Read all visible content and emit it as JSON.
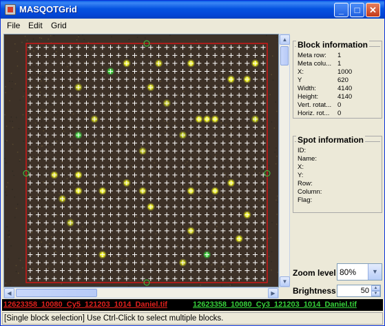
{
  "window": {
    "title": "MASQOTGrid",
    "buttons": [
      "minimize",
      "maximize",
      "close"
    ]
  },
  "menu": {
    "items": [
      "File",
      "Edit",
      "Grid"
    ]
  },
  "block_info": {
    "title": "Block information",
    "rows": [
      {
        "k": "Meta row:",
        "v": "1"
      },
      {
        "k": "Meta colu...",
        "v": "1"
      },
      {
        "k": "X:",
        "v": "1000"
      },
      {
        "k": "Y",
        "v": "620"
      },
      {
        "k": "Width:",
        "v": "4140"
      },
      {
        "k": "Height:",
        "v": "4140"
      },
      {
        "k": "Vert. rotat...",
        "v": "0"
      },
      {
        "k": "Horiz. rot...",
        "v": "0"
      }
    ]
  },
  "spot_info": {
    "title": "Spot information",
    "rows": [
      {
        "k": "ID:",
        "v": ""
      },
      {
        "k": "Name:",
        "v": ""
      },
      {
        "k": "X:",
        "v": ""
      },
      {
        "k": "Y:",
        "v": ""
      },
      {
        "k": "Row:",
        "v": ""
      },
      {
        "k": "Column:",
        "v": ""
      },
      {
        "k": "Flag:",
        "v": ""
      }
    ]
  },
  "zoom": {
    "label": "Zoom level",
    "value": "80%"
  },
  "brightness": {
    "label": "Brightness",
    "value": "50"
  },
  "files": {
    "cy5": "12623358_10080_Cy5_121203_1014_Daniel.tif",
    "cy3": "12623358_10080_Cy3_121203_1014_Daniel.tif",
    "cy5_color": "#e0201c",
    "cy3_color": "#36d23a"
  },
  "status": "[Single block selection] Use Ctrl-Click to select multiple blocks.",
  "grid": {
    "rows": 30,
    "cols": 30,
    "border_color": "#d01818",
    "marker_color": "#ffffff"
  },
  "spots": [
    {
      "r": 2,
      "c": 12,
      "color": "#e6e81a"
    },
    {
      "r": 2,
      "c": 16,
      "color": "#d4d41a"
    },
    {
      "r": 2,
      "c": 20,
      "color": "#e6e81a"
    },
    {
      "r": 2,
      "c": 28,
      "color": "#e6e81a"
    },
    {
      "r": 3,
      "c": 10,
      "color": "#3fd23f"
    },
    {
      "r": 4,
      "c": 25,
      "color": "#e6e81a"
    },
    {
      "r": 4,
      "c": 27,
      "color": "#e6e81a"
    },
    {
      "r": 5,
      "c": 6,
      "color": "#c7cb1a"
    },
    {
      "r": 5,
      "c": 15,
      "color": "#d6da1c"
    },
    {
      "r": 9,
      "c": 21,
      "color": "#e6e81a"
    },
    {
      "r": 9,
      "c": 22,
      "color": "#e6e81a"
    },
    {
      "r": 9,
      "c": 23,
      "color": "#e6e81a"
    },
    {
      "r": 9,
      "c": 28,
      "color": "#c6d01a"
    },
    {
      "r": 9,
      "c": 8,
      "color": "#c6c81a"
    },
    {
      "r": 11,
      "c": 6,
      "color": "#3fd23f"
    },
    {
      "r": 11,
      "c": 19,
      "color": "#b6c21a"
    },
    {
      "r": 16,
      "c": 3,
      "color": "#d6d81a"
    },
    {
      "r": 16,
      "c": 6,
      "color": "#e6e81a"
    },
    {
      "r": 17,
      "c": 12,
      "color": "#d6d81a"
    },
    {
      "r": 17,
      "c": 25,
      "color": "#e6e81a"
    },
    {
      "r": 18,
      "c": 6,
      "color": "#e6e81a"
    },
    {
      "r": 18,
      "c": 9,
      "color": "#e6e81a"
    },
    {
      "r": 18,
      "c": 14,
      "color": "#d6d81a"
    },
    {
      "r": 18,
      "c": 20,
      "color": "#e6e81a"
    },
    {
      "r": 18,
      "c": 23,
      "color": "#e6e81a"
    },
    {
      "r": 19,
      "c": 4,
      "color": "#c6c81a"
    },
    {
      "r": 20,
      "c": 15,
      "color": "#e6e81a"
    },
    {
      "r": 21,
      "c": 27,
      "color": "#e6e81a"
    },
    {
      "r": 23,
      "c": 20,
      "color": "#d6d81a"
    },
    {
      "r": 24,
      "c": 26,
      "color": "#e6e81a"
    },
    {
      "r": 26,
      "c": 9,
      "color": "#e6e81a"
    },
    {
      "r": 26,
      "c": 22,
      "color": "#3fd23f"
    },
    {
      "r": 27,
      "c": 19,
      "color": "#c6c81a"
    },
    {
      "r": 13,
      "c": 14,
      "color": "#b8bc1a"
    },
    {
      "r": 7,
      "c": 17,
      "color": "#b8bc1a"
    },
    {
      "r": 22,
      "c": 5,
      "color": "#b8bc1a"
    }
  ]
}
